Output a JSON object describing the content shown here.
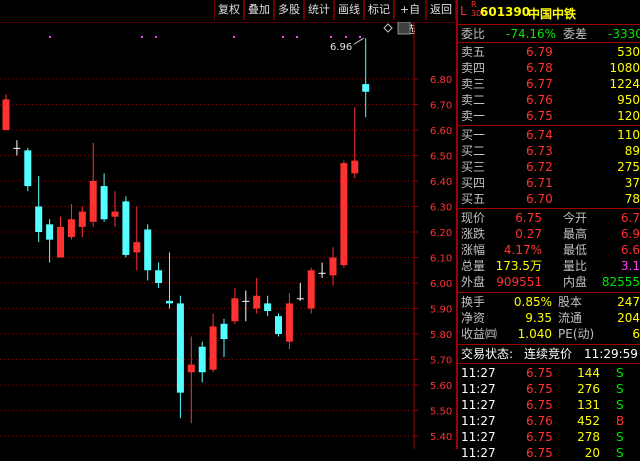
{
  "toolbar": {
    "buttons": [
      "复权",
      "叠加",
      "多股",
      "统计",
      "画线",
      "标记",
      "+自选",
      "返回"
    ]
  },
  "chart": {
    "y_ticks": [
      "6.80",
      "6.70",
      "6.60",
      "6.50",
      "6.40",
      "6.30",
      "6.20",
      "6.10",
      "6.00",
      "5.90",
      "5.80",
      "5.70",
      "5.60",
      "5.50",
      "5.40"
    ],
    "high_label": "6.96",
    "up_color": "#ff3232",
    "down_color": "#54ffff",
    "grid_color": "#8a0000",
    "candles": [
      {
        "o": 6.6,
        "c": 6.72,
        "h": 6.74,
        "l": 6.6
      },
      {
        "o": 6.53,
        "c": 6.53,
        "h": 6.56,
        "l": 6.5
      },
      {
        "o": 6.52,
        "c": 6.38,
        "h": 6.53,
        "l": 6.36
      },
      {
        "o": 6.3,
        "c": 6.2,
        "h": 6.42,
        "l": 6.16
      },
      {
        "o": 6.23,
        "c": 6.17,
        "h": 6.25,
        "l": 6.08
      },
      {
        "o": 6.1,
        "c": 6.22,
        "h": 6.26,
        "l": 6.1
      },
      {
        "o": 6.18,
        "c": 6.25,
        "h": 6.31,
        "l": 6.17
      },
      {
        "o": 6.22,
        "c": 6.28,
        "h": 6.3,
        "l": 6.18
      },
      {
        "o": 6.24,
        "c": 6.4,
        "h": 6.55,
        "l": 6.22
      },
      {
        "o": 6.38,
        "c": 6.25,
        "h": 6.43,
        "l": 6.24
      },
      {
        "o": 6.26,
        "c": 6.28,
        "h": 6.36,
        "l": 6.22
      },
      {
        "o": 6.32,
        "c": 6.11,
        "h": 6.34,
        "l": 6.1
      },
      {
        "o": 6.12,
        "c": 6.16,
        "h": 6.3,
        "l": 6.05
      },
      {
        "o": 6.21,
        "c": 6.05,
        "h": 6.23,
        "l": 6.01
      },
      {
        "o": 6.05,
        "c": 6.0,
        "h": 6.08,
        "l": 5.98
      },
      {
        "o": 5.93,
        "c": 5.92,
        "h": 6.12,
        "l": 5.9
      },
      {
        "o": 5.92,
        "c": 5.57,
        "h": 5.95,
        "l": 5.47
      },
      {
        "o": 5.65,
        "c": 5.68,
        "h": 5.79,
        "l": 5.45
      },
      {
        "o": 5.75,
        "c": 5.65,
        "h": 5.77,
        "l": 5.61
      },
      {
        "o": 5.66,
        "c": 5.83,
        "h": 5.88,
        "l": 5.65
      },
      {
        "o": 5.84,
        "c": 5.78,
        "h": 5.86,
        "l": 5.71
      },
      {
        "o": 5.85,
        "c": 5.94,
        "h": 5.98,
        "l": 5.84
      },
      {
        "o": 5.93,
        "c": 5.93,
        "h": 5.97,
        "l": 5.85
      },
      {
        "o": 5.9,
        "c": 5.95,
        "h": 6.02,
        "l": 5.88
      },
      {
        "o": 5.92,
        "c": 5.89,
        "h": 5.95,
        "l": 5.87
      },
      {
        "o": 5.87,
        "c": 5.8,
        "h": 5.88,
        "l": 5.79
      },
      {
        "o": 5.77,
        "c": 5.92,
        "h": 5.96,
        "l": 5.74
      },
      {
        "o": 5.94,
        "c": 5.94,
        "h": 6.0,
        "l": 5.93
      },
      {
        "o": 5.9,
        "c": 6.05,
        "h": 6.06,
        "l": 5.88
      },
      {
        "o": 6.04,
        "c": 6.04,
        "h": 6.08,
        "l": 6.02
      },
      {
        "o": 6.03,
        "c": 6.1,
        "h": 6.14,
        "l": 5.99
      },
      {
        "o": 6.07,
        "c": 6.47,
        "h": 6.48,
        "l": 6.06
      },
      {
        "o": 6.43,
        "c": 6.48,
        "h": 6.69,
        "l": 6.41
      },
      {
        "o": 6.78,
        "c": 6.75,
        "h": 6.96,
        "l": 6.65
      }
    ]
  },
  "quote": {
    "market_prefix": "L",
    "rights_mark": "R",
    "exchange_digits": "300",
    "code": "601390",
    "name": "中国中铁",
    "weibi_label": "委比",
    "weibi_value": "-74.16%",
    "weicha_label": "委差",
    "weicha_value": "-3330",
    "asks": [
      {
        "label": "卖五",
        "price": "6.79",
        "vol": "530"
      },
      {
        "label": "卖四",
        "price": "6.78",
        "vol": "1080"
      },
      {
        "label": "卖三",
        "price": "6.77",
        "vol": "1224"
      },
      {
        "label": "卖二",
        "price": "6.76",
        "vol": "950"
      },
      {
        "label": "卖一",
        "price": "6.75",
        "vol": "120"
      }
    ],
    "bids": [
      {
        "label": "买一",
        "price": "6.74",
        "vol": "110"
      },
      {
        "label": "买二",
        "price": "6.73",
        "vol": "89"
      },
      {
        "label": "买三",
        "price": "6.72",
        "vol": "275"
      },
      {
        "label": "买四",
        "price": "6.71",
        "vol": "37"
      },
      {
        "label": "买五",
        "price": "6.70",
        "vol": "78"
      }
    ],
    "stats": [
      {
        "l1": "现价",
        "v1": "6.75",
        "l2": "今开",
        "v2": "6.7"
      },
      {
        "l1": "涨跌",
        "v1": "0.27",
        "l2": "最高",
        "v2": "6.9"
      },
      {
        "l1": "涨幅",
        "v1": "4.17%",
        "l2": "最低",
        "v2": "6.6"
      },
      {
        "l1": "总量",
        "v1": "173.5万",
        "l2": "量比",
        "v2": "3.1"
      },
      {
        "l1": "外盘",
        "v1": "909551",
        "l2": "内盘",
        "v2": "82555"
      }
    ],
    "stats2": [
      {
        "l1": "换手",
        "v1": "0.85%",
        "l2": "股本",
        "v2": "247"
      },
      {
        "l1": "净资",
        "v1": "9.35",
        "l2": "流通",
        "v2": "204"
      },
      {
        "l1": "收益㈣",
        "v1": "1.040",
        "l2": "PE(动)",
        "v2": "6"
      }
    ],
    "trade_status_label": "交易状态:",
    "trade_status_value": "连续竞价",
    "trade_time": "11:29:59",
    "ticks": [
      {
        "time": "11:27",
        "price": "6.75",
        "vol": "144",
        "side": "S"
      },
      {
        "time": "11:27",
        "price": "6.75",
        "vol": "276",
        "side": "S"
      },
      {
        "time": "11:27",
        "price": "6.75",
        "vol": "131",
        "side": "S"
      },
      {
        "time": "11:27",
        "price": "6.76",
        "vol": "452",
        "side": "B"
      },
      {
        "time": "11:27",
        "price": "6.75",
        "vol": "278",
        "side": "S"
      },
      {
        "time": "11:27",
        "price": "6.75",
        "vol": "20",
        "side": "S"
      }
    ]
  }
}
